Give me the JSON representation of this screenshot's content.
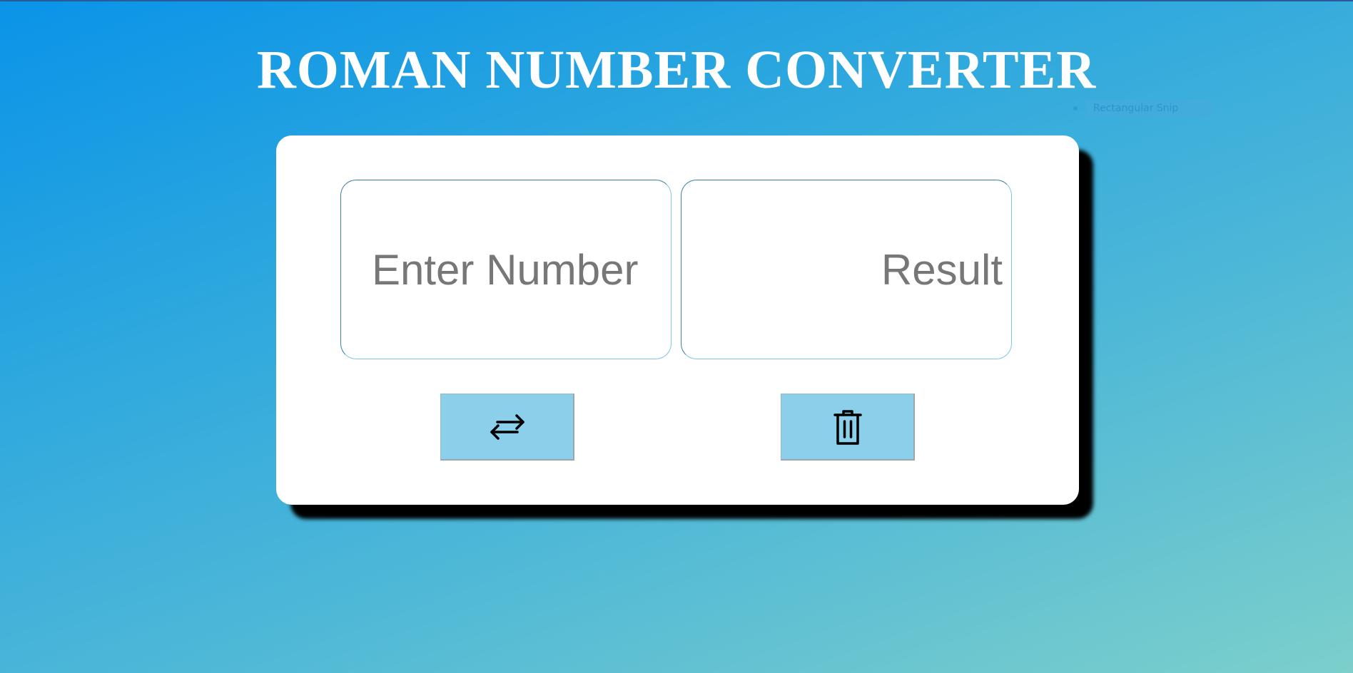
{
  "page": {
    "title": "ROMAN NUMBER CONVERTER",
    "background_gradient": [
      "#0a93e8",
      "#2aa6df",
      "#4bb6d8",
      "#7ccfcb"
    ]
  },
  "overlay": {
    "snip_label": "Rectangular Snip"
  },
  "converter": {
    "input": {
      "value": "",
      "placeholder": "Enter Number"
    },
    "output": {
      "value": "",
      "placeholder": "Result"
    },
    "convert_button": {
      "icon": "swap-arrows-icon",
      "label": "Convert"
    },
    "clear_button": {
      "icon": "trash-icon",
      "label": "Clear"
    },
    "accent_color": "#8bcfeb"
  }
}
